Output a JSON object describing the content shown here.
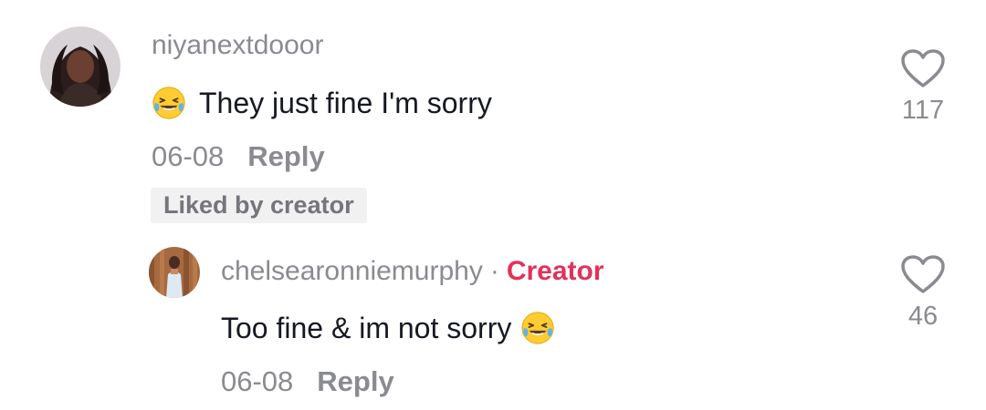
{
  "comments": [
    {
      "username": "niyanextdooor",
      "text": "They just fine I'm sorry",
      "date": "06-08",
      "reply_label": "Reply",
      "badge": "Liked by creator",
      "likes": "117"
    }
  ],
  "replies": [
    {
      "username": "chelsearonniemurphy",
      "separator": "·",
      "role_badge": "Creator",
      "text": "Too fine & im not sorry",
      "date": "06-08",
      "reply_label": "Reply",
      "likes": "46"
    }
  ],
  "colors": {
    "creator_accent": "#e2315a",
    "muted_text": "#8a8b91",
    "body_text": "#161823"
  },
  "icons": {
    "emoji": "face-with-tears-of-joy",
    "like": "heart-outline-icon"
  }
}
